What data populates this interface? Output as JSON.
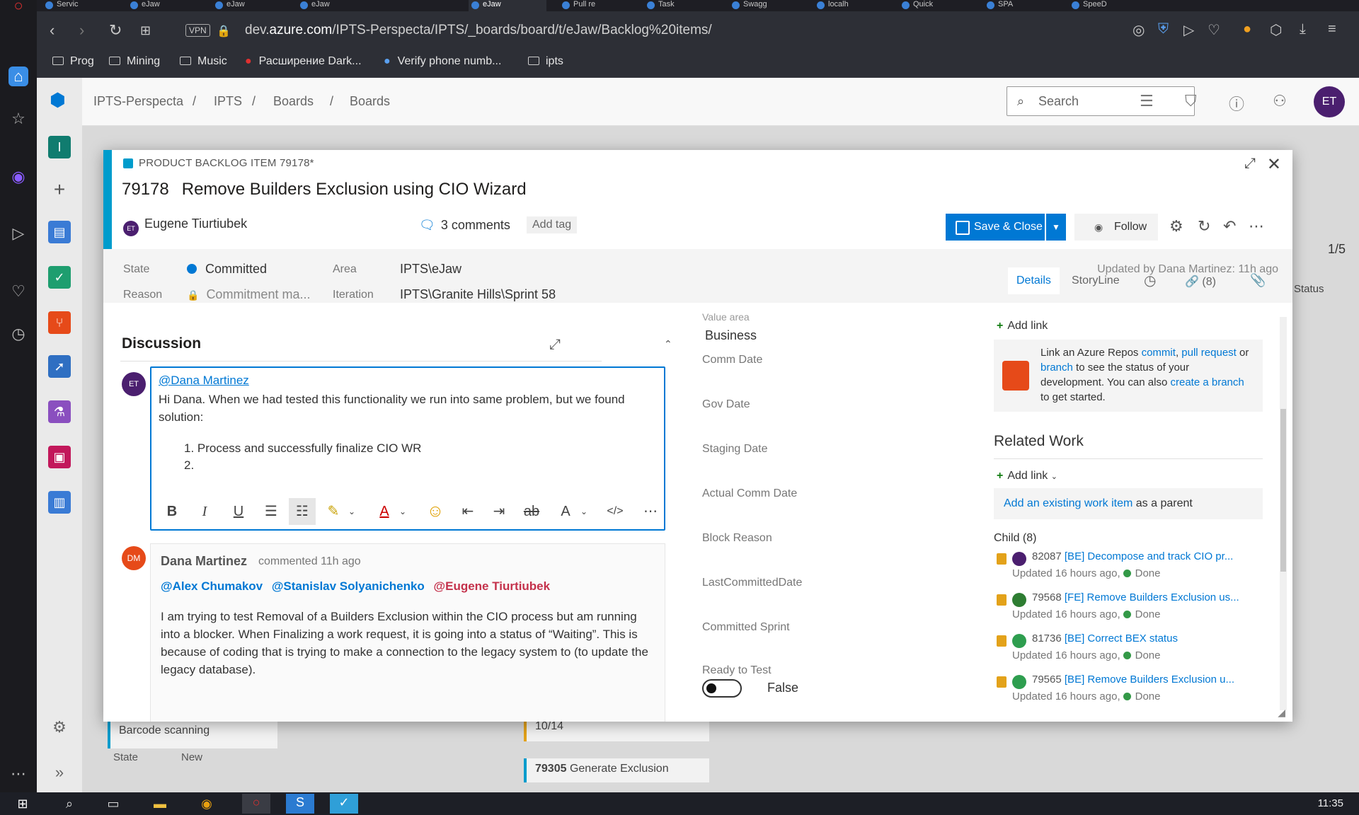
{
  "browser": {
    "tabs": [
      "Servic",
      "eJaw",
      "eJaw",
      "eJaw",
      "eJaw",
      "Pull re",
      "Task",
      "Swagg",
      "localh",
      "Quick",
      "SPA",
      "SpeeD"
    ],
    "vpn": "VPN",
    "url_prefix": "dev.",
    "url_domain": "azure.com",
    "url_path": "/IPTS-Perspecta/IPTS/_boards/board/t/eJaw/Backlog%20items/",
    "bookmarks": [
      "Prog",
      "Mining",
      "Music",
      "Расширение Dark...",
      "Verify phone numb...",
      "ipts"
    ]
  },
  "ado": {
    "breadcrumbs": [
      "IPTS-Perspecta",
      "IPTS",
      "Boards",
      "Boards"
    ],
    "search_placeholder": "Search",
    "user_initials": "ET",
    "project_initial": "I",
    "board_count": "1/5",
    "board_status": "Status",
    "board_cards": [
      "Barcode scanning",
      "10/14",
      "79305",
      "Generate Exclusion"
    ],
    "board_state_label": "State",
    "board_state_value": "New"
  },
  "workitem": {
    "type_label": "PRODUCT BACKLOG ITEM 79178*",
    "id": "79178",
    "title": "Remove Builders Exclusion using CIO Wizard",
    "assignee": "Eugene Tiurtiubek",
    "assignee_initials": "ET",
    "comments": "3 comments",
    "add_tag": "Add tag",
    "save_close": "Save & Close",
    "follow": "Follow",
    "updated": "Updated by Dana Martinez: 11h ago",
    "fields": {
      "state_label": "State",
      "state_value": "Committed",
      "reason_label": "Reason",
      "reason_value": "Commitment ma...",
      "area_label": "Area",
      "area_value": "IPTS\\eJaw",
      "iteration_label": "Iteration",
      "iteration_value": "IPTS\\Granite Hills\\Sprint 58"
    },
    "page_tabs": [
      "Details",
      "StoryLine",
      "(8)"
    ]
  },
  "discussion": {
    "title": "Discussion",
    "editor": {
      "mention": "@Dana Martinez",
      "text": "Hi Dana. When we had tested this functionality we run into same problem, but we found solution:",
      "list_items": [
        "1. Process and successfully finalize CIO WR",
        "2."
      ]
    },
    "comment": {
      "initials": "DM",
      "author": "Dana Martinez",
      "time": "commented 11h ago",
      "mentions": [
        "@Alex Chumakov",
        "@Stanislav Solyanichenko",
        "@Eugene Tiurtiubek"
      ],
      "body": "I am trying to test Removal of a Builders Exclusion within the CIO process but am running into a blocker. When Finalizing a work request, it is going into a status of “Waiting”. This is because of coding that is trying to make a connection to the legacy system to (to update the legacy database)."
    }
  },
  "middle_fields": {
    "value_area_label": "Value area",
    "value_area": "Business",
    "labels": [
      "Comm Date",
      "Gov Date",
      "Staging Date",
      "Actual Comm Date",
      "Block Reason",
      "LastCommittedDate",
      "Committed Sprint",
      "Ready to Test"
    ],
    "ready_to_test": "False"
  },
  "right_panel": {
    "add_link": "Add link",
    "repo_text_1": "Link an Azure Repos ",
    "repo_commit": "commit",
    "repo_pr": "pull request",
    "repo_or": " or ",
    "repo_branch": "branch",
    "repo_text_2": " to see the status of your development. You can also ",
    "repo_create": "create a branch",
    "repo_text_3": " to get started.",
    "related_work": "Related Work",
    "add_link_2": "Add link",
    "parent_link": "Add an existing work item",
    "parent_suffix": " as a parent",
    "child_label": "Child (8)",
    "children": [
      {
        "id": "82087",
        "title": "[BE] Decompose and track CIO pr...",
        "updated": "Updated 16 hours ago,",
        "status": "Done"
      },
      {
        "id": "79568",
        "title": "[FE] Remove Builders Exclusion us...",
        "updated": "Updated 16 hours ago,",
        "status": "Done"
      },
      {
        "id": "81736",
        "title": "[BE] Correct BEX status",
        "updated": "Updated 16 hours ago,",
        "status": "Done"
      },
      {
        "id": "79565",
        "title": "[BE] Remove Builders Exclusion u...",
        "updated": "Updated 16 hours ago,",
        "status": "Done"
      }
    ]
  },
  "taskbar": {
    "clock": "11:35"
  }
}
